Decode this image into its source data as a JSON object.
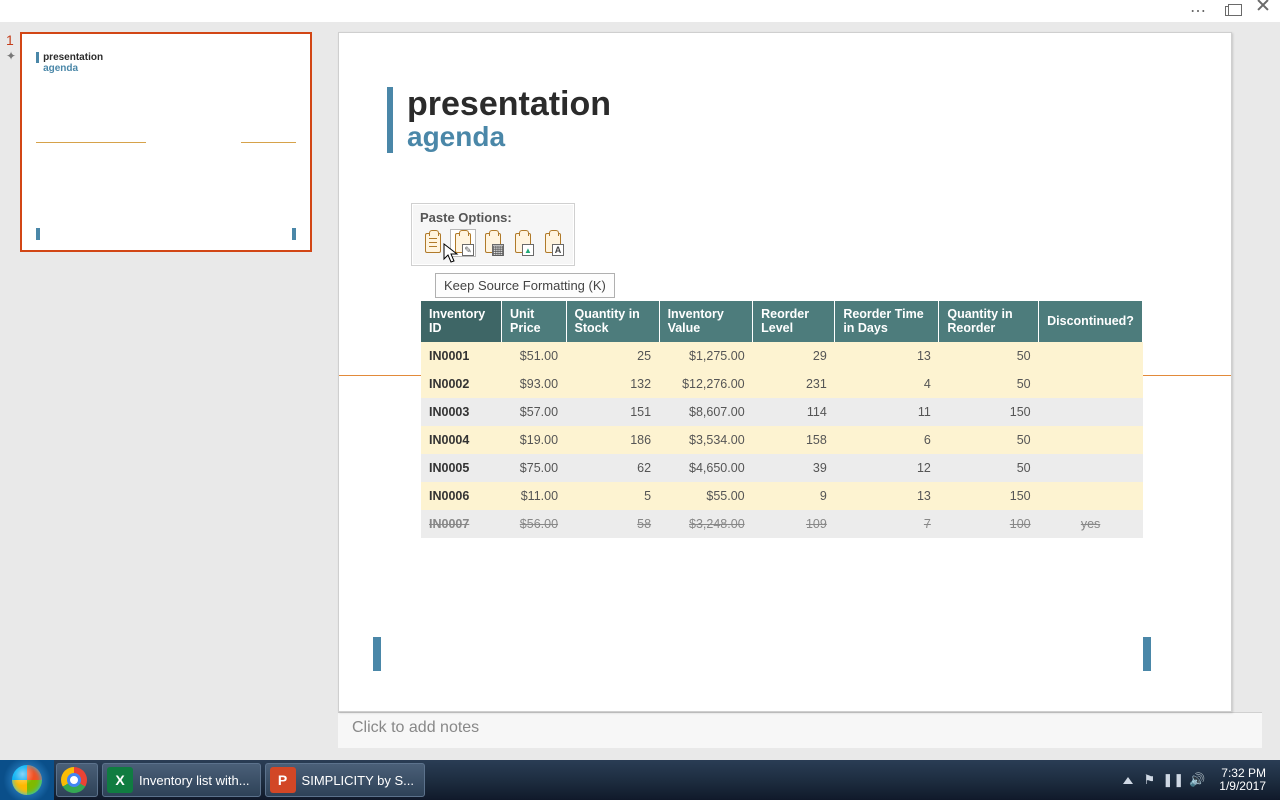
{
  "window": {
    "ellipsis": "⋯"
  },
  "slide": {
    "title": "presentation",
    "subtitle": "agenda",
    "number": "1"
  },
  "paste": {
    "label": "Paste Options:",
    "tooltip": "Keep Source Formatting (K)"
  },
  "table": {
    "headers": [
      "Inventory ID",
      "Unit Price",
      "Quantity in Stock",
      "Inventory Value",
      "Reorder Level",
      "Reorder Time in Days",
      "Quantity in Reorder",
      "Discontinued?"
    ],
    "rows": [
      {
        "id": "IN0001",
        "price": "$51.00",
        "qty": "25",
        "value": "$1,275.00",
        "reorder": "29",
        "days": "13",
        "qreorder": "50",
        "disc": "",
        "cls": "y"
      },
      {
        "id": "IN0002",
        "price": "$93.00",
        "qty": "132",
        "value": "$12,276.00",
        "reorder": "231",
        "days": "4",
        "qreorder": "50",
        "disc": "",
        "cls": "y"
      },
      {
        "id": "IN0003",
        "price": "$57.00",
        "qty": "151",
        "value": "$8,607.00",
        "reorder": "114",
        "days": "11",
        "qreorder": "150",
        "disc": "",
        "cls": "g"
      },
      {
        "id": "IN0004",
        "price": "$19.00",
        "qty": "186",
        "value": "$3,534.00",
        "reorder": "158",
        "days": "6",
        "qreorder": "50",
        "disc": "",
        "cls": "y"
      },
      {
        "id": "IN0005",
        "price": "$75.00",
        "qty": "62",
        "value": "$4,650.00",
        "reorder": "39",
        "days": "12",
        "qreorder": "50",
        "disc": "",
        "cls": "g"
      },
      {
        "id": "IN0006",
        "price": "$11.00",
        "qty": "5",
        "value": "$55.00",
        "reorder": "9",
        "days": "13",
        "qreorder": "150",
        "disc": "",
        "cls": "y"
      },
      {
        "id": "IN0007",
        "price": "$56.00",
        "qty": "58",
        "value": "$3,248.00",
        "reorder": "109",
        "days": "7",
        "qreorder": "100",
        "disc": "yes",
        "cls": "g strike"
      }
    ]
  },
  "notes": {
    "placeholder": "Click to add notes"
  },
  "taskbar": {
    "excel_label": "Inventory list with...",
    "ppt_label": "SIMPLICITY by S...",
    "time": "7:32 PM",
    "date": "1/9/2017"
  }
}
